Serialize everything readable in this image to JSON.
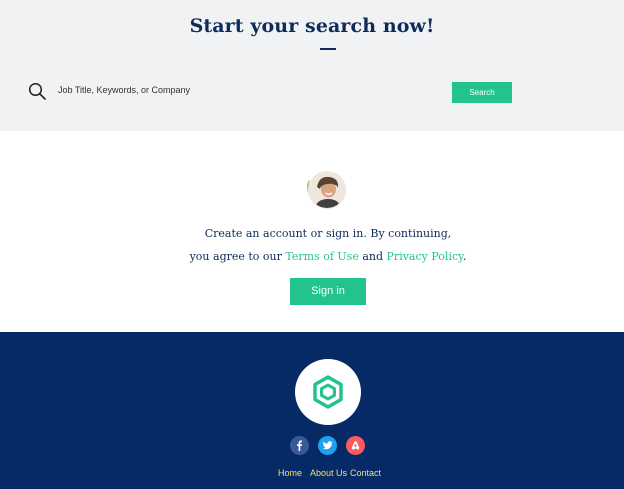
{
  "search_section": {
    "headline": "Start your search now!",
    "input_placeholder": "Job Title, Keywords, or Company",
    "input_value": "",
    "search_button_label": "Search",
    "search_icon": "magnifier-icon"
  },
  "account_section": {
    "avatar": "user-avatar-photo",
    "line_1": "Create an account or sign in. By continuing,",
    "line_2_prefix": "you agree to our ",
    "terms_link": "Terms of Use",
    "and_text": " and ",
    "privacy_link": "Privacy Policy",
    "line_2_suffix": ".",
    "signin_button_label": "Sign in"
  },
  "footer": {
    "logo": "hexagon-logo",
    "social": [
      {
        "icon": "facebook-icon",
        "color": "#3b5998"
      },
      {
        "icon": "twitter-icon",
        "color": "#1da1f2"
      },
      {
        "icon": "airbnb-icon",
        "color": "#ff5a5f"
      }
    ],
    "links": [
      "Home",
      "About Us",
      "Contact"
    ]
  },
  "colors": {
    "accent": "#22c38e",
    "headline": "#0e2b5c",
    "footer_background": "#052a66",
    "footer_link": "#f1e46b",
    "search_background": "#f1f2f4"
  }
}
